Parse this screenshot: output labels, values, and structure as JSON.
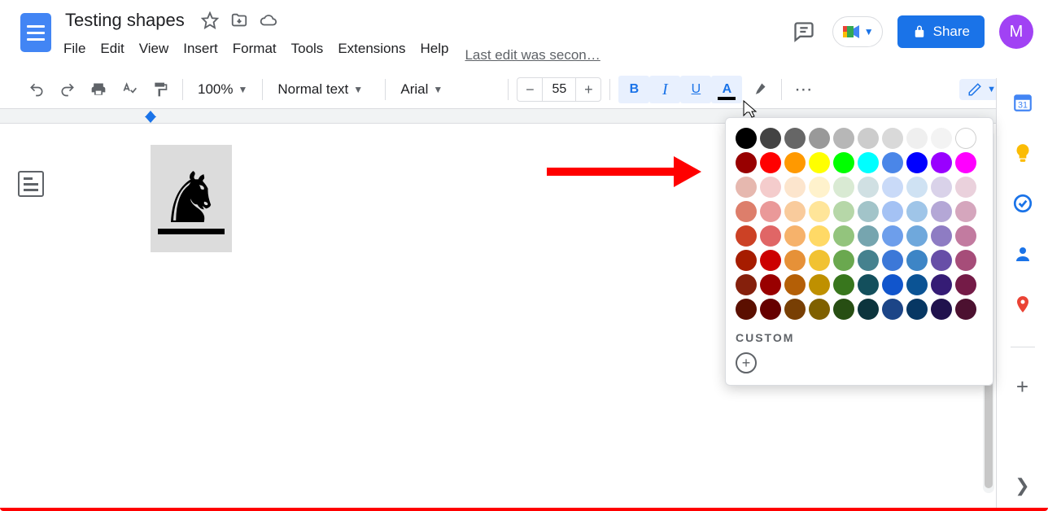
{
  "header": {
    "title": "Testing shapes",
    "menus": [
      "File",
      "Edit",
      "View",
      "Insert",
      "Format",
      "Tools",
      "Extensions",
      "Help"
    ],
    "last_edit": "Last edit was secon…",
    "share_label": "Share",
    "avatar_letter": "M"
  },
  "toolbar": {
    "zoom": "100%",
    "style": "Normal text",
    "font": "Arial",
    "font_size": "55",
    "bold": "B",
    "italic": "I",
    "underline": "U",
    "text_color": "A"
  },
  "color_picker": {
    "custom_label": "CUSTOM",
    "rows": [
      [
        "#000000",
        "#434343",
        "#666666",
        "#999999",
        "#b7b7b7",
        "#cccccc",
        "#d9d9d9",
        "#efefef",
        "#f3f3f3",
        "#ffffff"
      ],
      [
        "#980000",
        "#ff0000",
        "#ff9900",
        "#ffff00",
        "#00ff00",
        "#00ffff",
        "#4a86e8",
        "#0000ff",
        "#9900ff",
        "#ff00ff"
      ],
      [
        "#e6b8af",
        "#f4cccc",
        "#fce5cd",
        "#fff2cc",
        "#d9ead3",
        "#d0e0e3",
        "#c9daf8",
        "#cfe2f3",
        "#d9d2e9",
        "#ead1dc"
      ],
      [
        "#dd7e6b",
        "#ea9999",
        "#f9cb9c",
        "#ffe599",
        "#b6d7a8",
        "#a2c4c9",
        "#a4c2f4",
        "#9fc5e8",
        "#b4a7d6",
        "#d5a6bd"
      ],
      [
        "#cc4125",
        "#e06666",
        "#f6b26b",
        "#ffd966",
        "#93c47d",
        "#76a5af",
        "#6d9eeb",
        "#6fa8dc",
        "#8e7cc3",
        "#c27ba0"
      ],
      [
        "#a61c00",
        "#cc0000",
        "#e69138",
        "#f1c232",
        "#6aa84f",
        "#45818e",
        "#3c78d8",
        "#3d85c6",
        "#674ea7",
        "#a64d79"
      ],
      [
        "#85200c",
        "#990000",
        "#b45f06",
        "#bf9000",
        "#38761d",
        "#134f5c",
        "#1155cc",
        "#0b5394",
        "#351c75",
        "#741b47"
      ],
      [
        "#5b0f00",
        "#660000",
        "#783f04",
        "#7f6000",
        "#274e13",
        "#0c343d",
        "#1c4587",
        "#073763",
        "#20124d",
        "#4c1130"
      ]
    ]
  },
  "side_panel": {
    "items": [
      "calendar",
      "keep",
      "tasks",
      "contacts",
      "maps"
    ]
  },
  "canvas": {
    "object": "chess-knight"
  }
}
